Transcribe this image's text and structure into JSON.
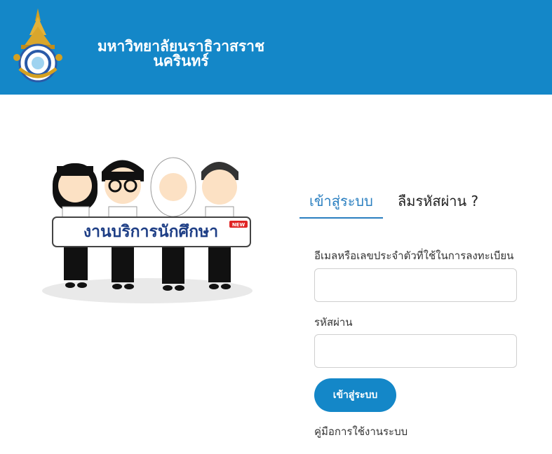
{
  "header": {
    "title_line1": "มหาวิทยาลัยนราธิวาสราช",
    "title_line2": "นครินทร์",
    "logo_icon": "university-crest-icon",
    "bg_color": "#1487c8"
  },
  "illustration": {
    "banner_text": "งานบริการนักศึกษา",
    "badge": "NEW"
  },
  "tabs": {
    "login": "เข้าสู่ระบบ",
    "forgot": "ลืมรหัสผ่าน ?"
  },
  "form": {
    "email_label": "อีเมลหรือเลขประจำตัวที่ใช้ในการลงทะเบียน",
    "email_value": "",
    "password_label": "รหัสผ่าน",
    "password_value": "",
    "submit_label": "เข้าสู่ระบบ",
    "manual_link": "คู่มือการใช้งานระบบ"
  }
}
